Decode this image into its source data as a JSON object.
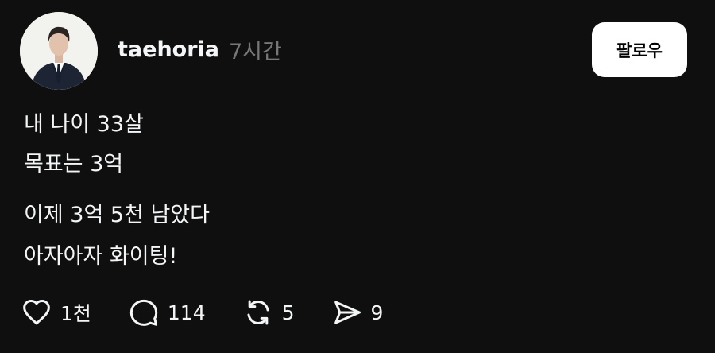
{
  "author": {
    "username": "taehoria",
    "time_ago": "7시간"
  },
  "follow_button": {
    "label": "팔로우"
  },
  "post": {
    "lines": [
      "내 나이 33살",
      "목표는 3억",
      "이제 3억 5천 남았다",
      "아자아자 화이팅!"
    ]
  },
  "actions": {
    "like_count": "1천",
    "comment_count": "114",
    "repost_count": "5",
    "share_count": "9"
  },
  "icons": {
    "like": "heart-icon",
    "comment": "speech-bubble-icon",
    "repost": "repost-arrows-icon",
    "share": "send-icon"
  },
  "colors": {
    "background": "#0f0f0f",
    "text": "#f3f5f7",
    "muted": "#777777",
    "button_bg": "#ffffff",
    "button_text": "#000000"
  }
}
